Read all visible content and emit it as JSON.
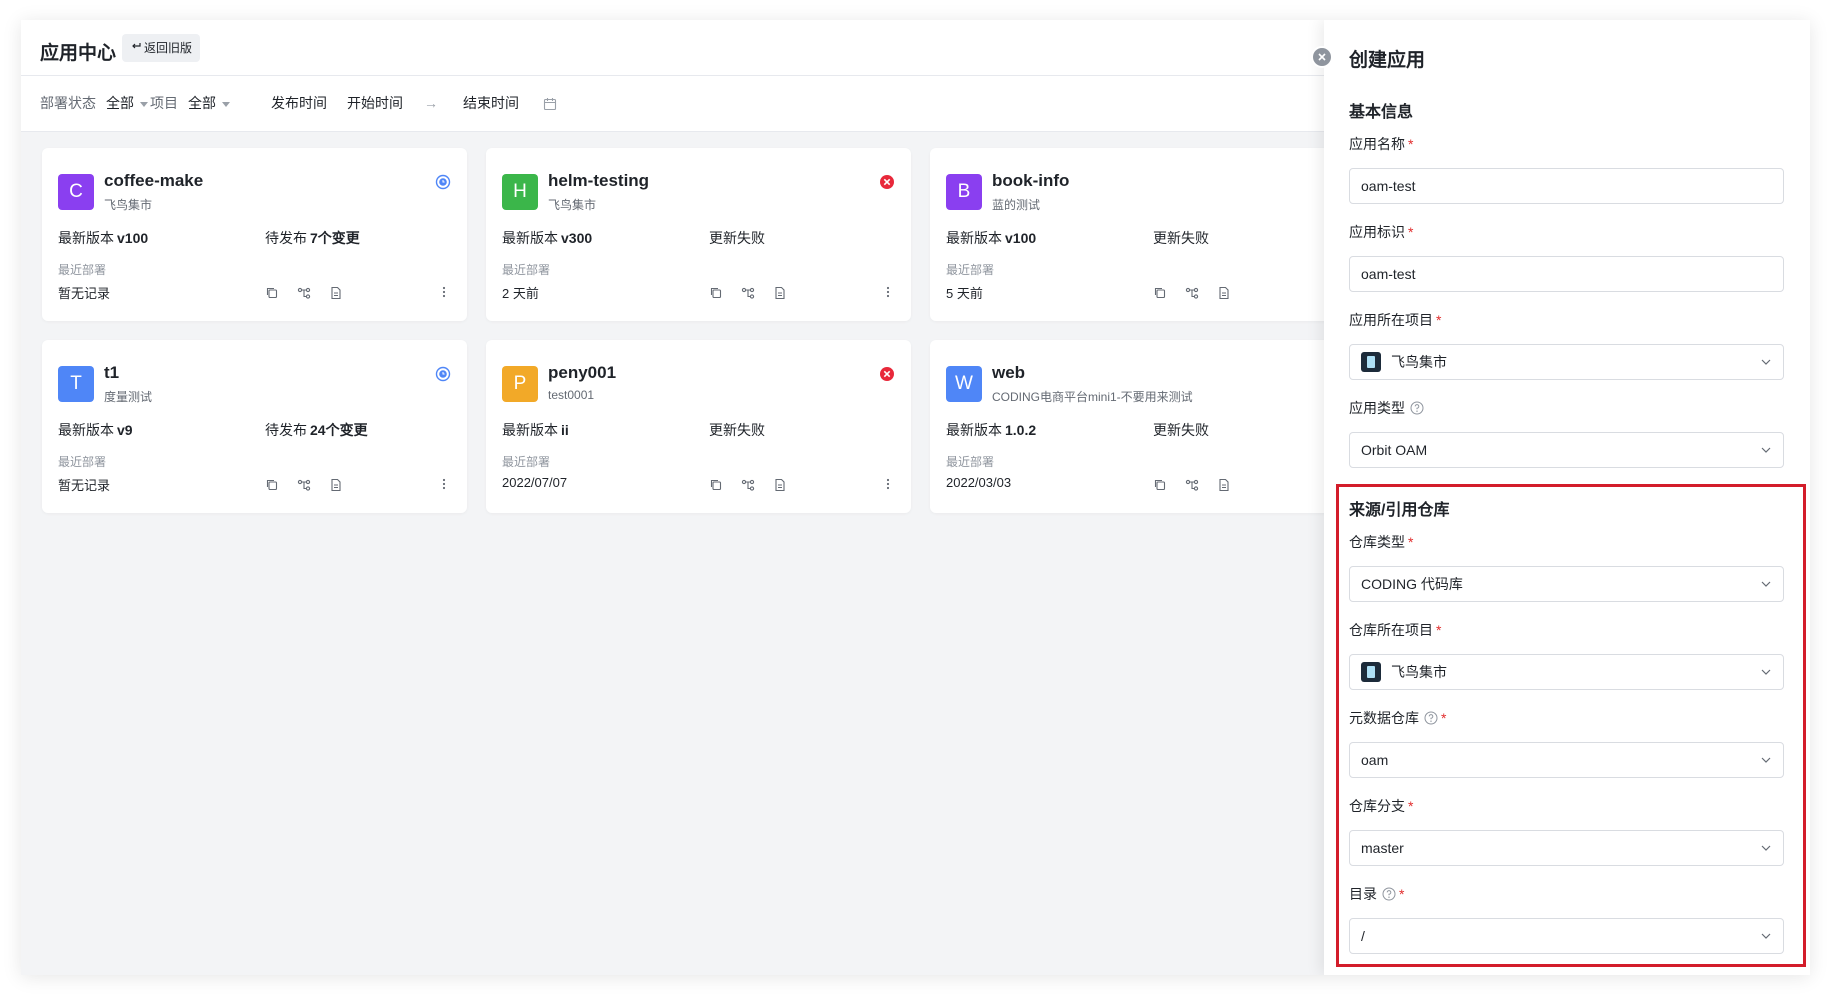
{
  "header": {
    "title": "应用中心",
    "back_label": "返回旧版"
  },
  "filters": {
    "deploy_status_label": "部署状态",
    "deploy_status_value": "全部",
    "project_label": "项目",
    "project_value": "全部",
    "publish_time_label": "发布时间",
    "start_time": "开始时间",
    "arrow": "→",
    "end_time": "结束时间"
  },
  "cards": [
    {
      "initial": "C",
      "color": "#8a3ff0",
      "name": "coffee-make",
      "project": "飞鸟集市",
      "version_label": "最新版本",
      "version": "v100",
      "publish_label": "待发布",
      "publish_value": "7个变更",
      "status": "pending",
      "deploy_label": "最近部署",
      "deploy_value": "暂无记录"
    },
    {
      "initial": "H",
      "color": "#3bb64a",
      "name": "helm-testing",
      "project": "飞鸟集市",
      "version_label": "最新版本",
      "version": "v300",
      "publish_label": "更新失败",
      "publish_value": "",
      "status": "failed",
      "deploy_label": "最近部署",
      "deploy_value": "2 天前"
    },
    {
      "initial": "B",
      "color": "#8a3ff0",
      "name": "book-info",
      "project": "蓝的测试",
      "version_label": "最新版本",
      "version": "v100",
      "publish_label": "更新失败",
      "publish_value": "",
      "status": "failed",
      "deploy_label": "最近部署",
      "deploy_value": "5 天前"
    },
    {
      "initial": "T",
      "color": "#4f86f7",
      "name": "t1",
      "project": "度量测试",
      "version_label": "最新版本",
      "version": "v9",
      "publish_label": "待发布",
      "publish_value": "24个变更",
      "status": "pending",
      "deploy_label": "最近部署",
      "deploy_value": "暂无记录"
    },
    {
      "initial": "P",
      "color": "#f2a928",
      "name": "peny001",
      "project": "test0001",
      "version_label": "最新版本",
      "version": "ii",
      "publish_label": "更新失败",
      "publish_value": "",
      "status": "failed",
      "deploy_label": "最近部署",
      "deploy_value": "2022/07/07"
    },
    {
      "initial": "W",
      "color": "#4f86f7",
      "name": "web",
      "project": "CODING电商平台mini1-不要用来测试",
      "version_label": "最新版本",
      "version": "1.0.2",
      "publish_label": "更新失败",
      "publish_value": "",
      "status": "failed",
      "deploy_label": "最近部署",
      "deploy_value": "2022/03/03"
    }
  ],
  "drawer": {
    "title": "创建应用",
    "basic_section": "基本信息",
    "app_name_label": "应用名称",
    "app_name_value": "oam-test",
    "app_id_label": "应用标识",
    "app_id_value": "oam-test",
    "app_project_label": "应用所在项目",
    "app_project_value": "飞鸟集市",
    "app_type_label": "应用类型",
    "app_type_value": "Orbit OAM",
    "source_section": "来源/引用仓库",
    "repo_type_label": "仓库类型",
    "repo_type_value": "CODING 代码库",
    "repo_project_label": "仓库所在项目",
    "repo_project_value": "飞鸟集市",
    "meta_repo_label": "元数据仓库",
    "meta_repo_value": "oam",
    "branch_label": "仓库分支",
    "branch_value": "master",
    "dir_label": "目录",
    "dir_value": "/"
  },
  "colors": {
    "required": "#e12d2d",
    "highlight": "#d31d2a",
    "pending": "#4f86f7",
    "failed": "#e8283a"
  }
}
